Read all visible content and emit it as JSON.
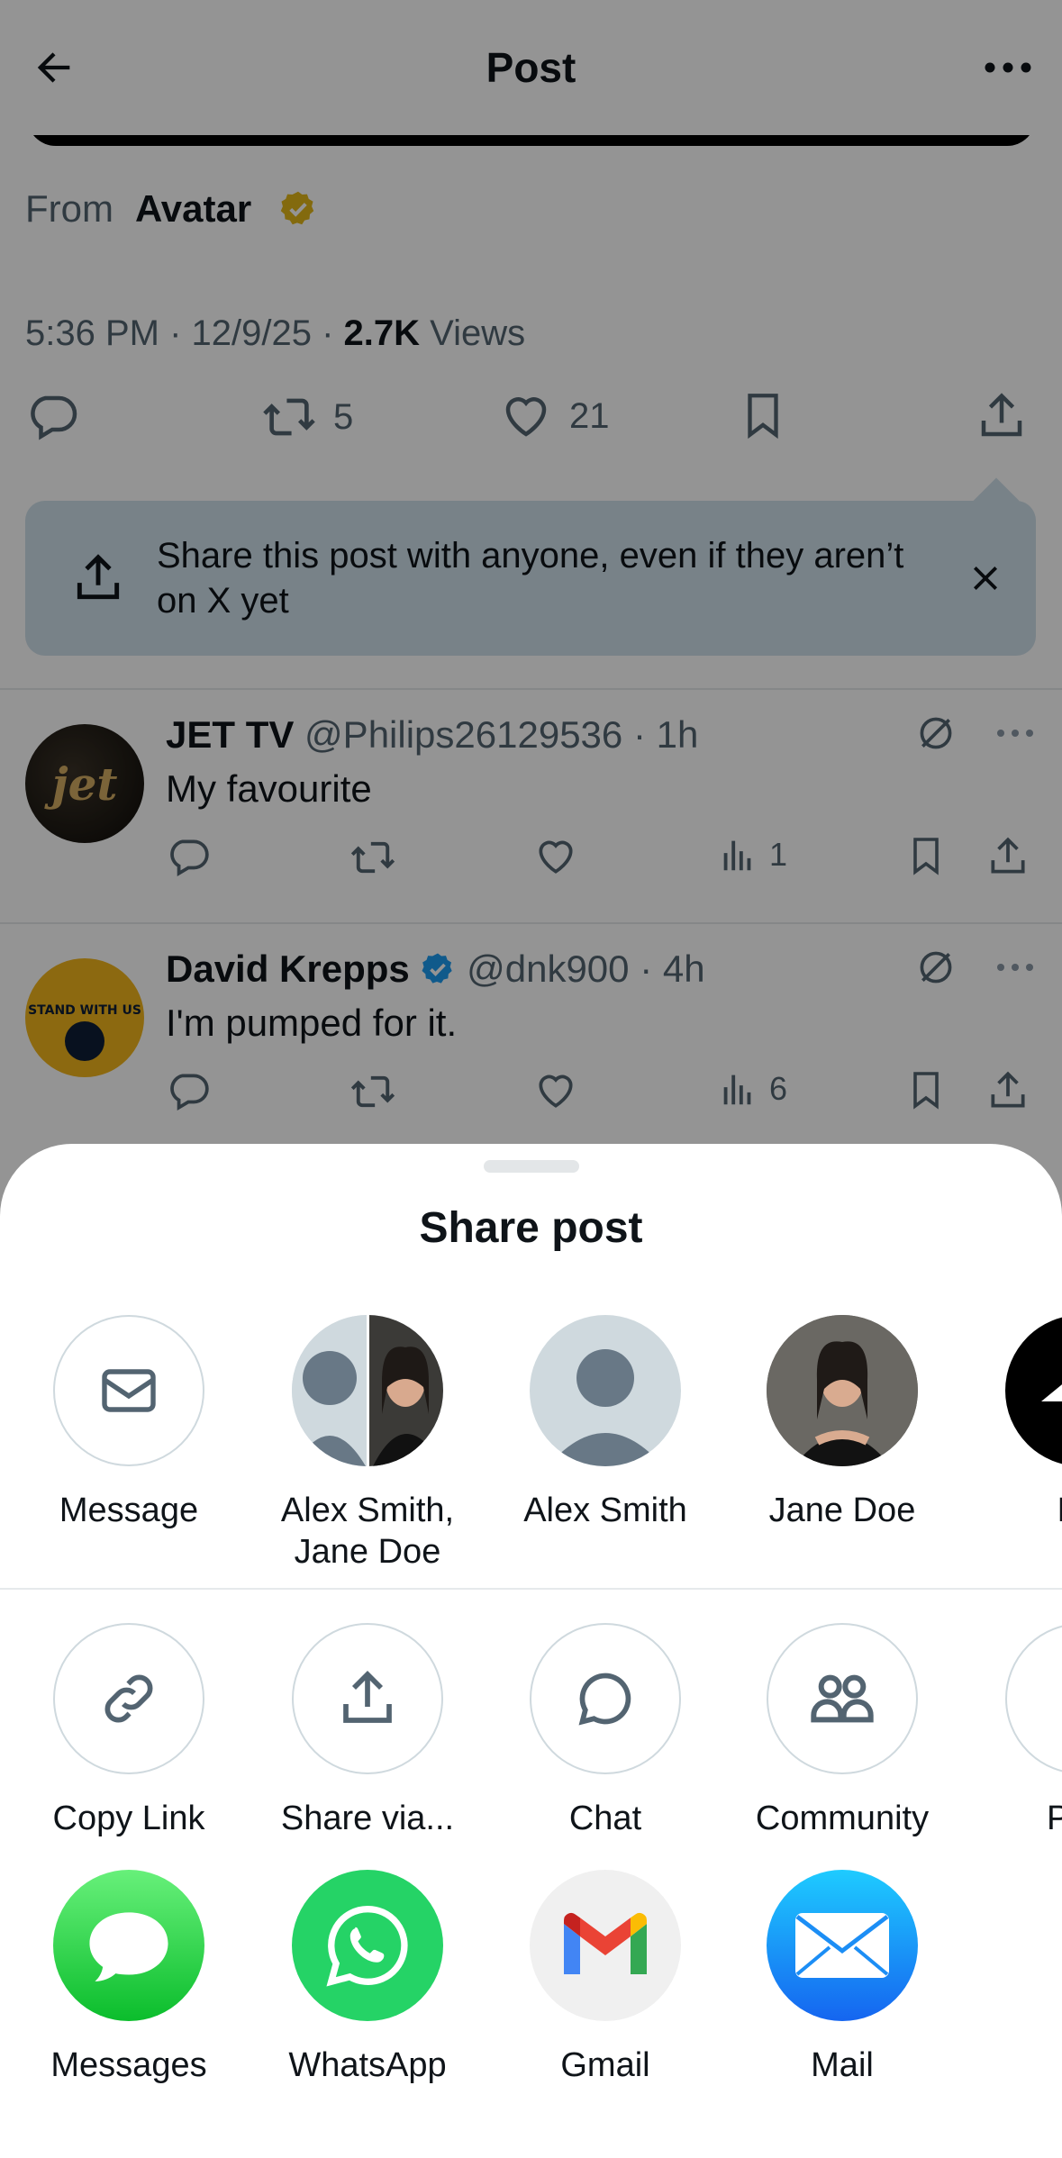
{
  "header": {
    "title": "Post"
  },
  "post": {
    "from_label": "From",
    "from_name": "Avatar",
    "time_date": "5:36 PM · 12/9/25 · ",
    "views_count": "2.7K",
    "views_label": " Views",
    "retweets": "5",
    "likes": "21"
  },
  "tip": {
    "text": "Share this post with anyone, even if they aren’t on X yet"
  },
  "replies": [
    {
      "name": "JET TV",
      "handle": "@Philips26129536 · 1h",
      "text": "My favourite",
      "views": "1",
      "avatar_text": "jet"
    },
    {
      "name": "David Krepps",
      "handle": "@dnk900 · 4h",
      "text": "I'm pumped for it.",
      "views": "6",
      "avatar_text": "STAND WITH US"
    }
  ],
  "share_sheet": {
    "title": "Share post",
    "contacts": [
      {
        "label": "Message"
      },
      {
        "label": "Alex Smith,\nJane Doe"
      },
      {
        "label": "Alex Smith"
      },
      {
        "label": "Jane Doe"
      },
      {
        "label": "Mo"
      }
    ],
    "actions": [
      {
        "label": "Copy Link"
      },
      {
        "label": "Share via..."
      },
      {
        "label": "Chat"
      },
      {
        "label": "Community"
      },
      {
        "label": "Post"
      }
    ],
    "apps": [
      {
        "label": "Messages"
      },
      {
        "label": "WhatsApp"
      },
      {
        "label": "Gmail"
      },
      {
        "label": "Mail"
      }
    ]
  },
  "colors": {
    "accent": "#1d9bf0",
    "verified_gold": "#e2b719",
    "tip_bg": "#cfe0ea",
    "whatsapp": "#25d366",
    "messages": "#34c759"
  }
}
